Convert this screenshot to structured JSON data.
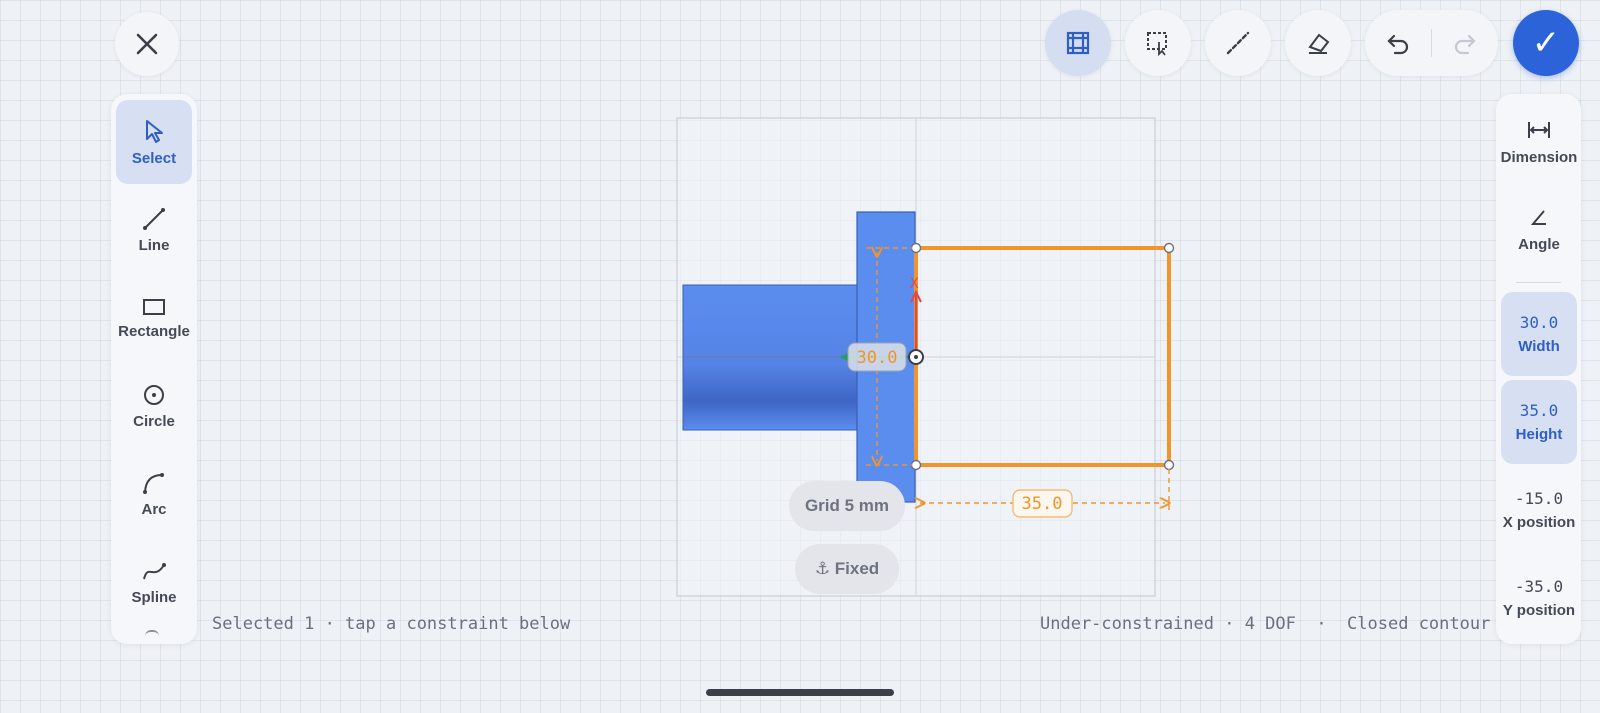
{
  "top_bar": {
    "close_icon": "close-icon",
    "tools": [
      "grid-icon",
      "box-select-icon",
      "dashed-line-icon",
      "eraser-icon"
    ],
    "undo_icon": "undo-icon",
    "redo_icon": "redo-icon",
    "confirm_label": "✓"
  },
  "left_toolbar": {
    "items": [
      {
        "label": "Select",
        "icon": "cursor-icon",
        "active": true
      },
      {
        "label": "Line",
        "icon": "line-icon"
      },
      {
        "label": "Rectangle",
        "icon": "rectangle-icon"
      },
      {
        "label": "Circle",
        "icon": "circle-icon"
      },
      {
        "label": "Arc",
        "icon": "arc-icon"
      },
      {
        "label": "Spline",
        "icon": "spline-icon"
      }
    ]
  },
  "right_panel": {
    "dimension_label": "Dimension",
    "angle_label": "Angle",
    "width": {
      "value": "30.0",
      "label": "Width"
    },
    "height": {
      "value": "35.0",
      "label": "Height"
    },
    "x_position": {
      "value": "-15.0",
      "label": "X position"
    },
    "y_position": {
      "value": "-35.0",
      "label": "Y position"
    }
  },
  "canvas": {
    "dim_vertical": "30.0",
    "dim_horizontal": "35.0",
    "axis_x_label": "X",
    "grid_chip": "Grid 5 mm",
    "fixed_chip": "⚓ Fixed"
  },
  "status": {
    "left": "Selected 1 · tap a constraint below",
    "right": "Under-constrained · 4 DOF  ·  Closed contour"
  },
  "colors": {
    "accent": "#2d63d8",
    "sketch": "#f0952b",
    "body": "#5b8def"
  }
}
